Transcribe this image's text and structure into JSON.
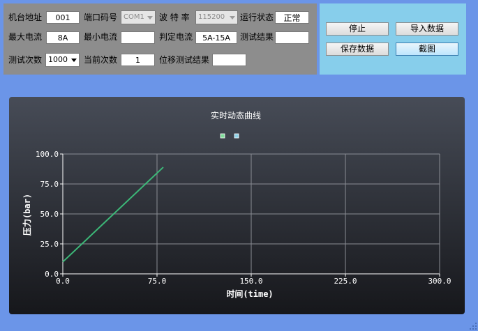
{
  "params": {
    "row1": {
      "machine_addr_label": "机台地址",
      "machine_addr_value": "001",
      "port_label": "端口码号",
      "port_value": "COM1",
      "baud_label": "波 特 率",
      "baud_value": "115200",
      "status_label": "运行状态",
      "status_value": "正常"
    },
    "row2": {
      "max_current_label": "最大电流",
      "max_current_value": "8A",
      "min_current_label": "最小电流",
      "min_current_value": "",
      "judge_current_label": "判定电流",
      "judge_current_value": "5A-15A",
      "test_result_label": "测试结果",
      "test_result_value": ""
    },
    "row3": {
      "test_count_label": "测试次数",
      "test_count_value": "1000",
      "current_count_label": "当前次数",
      "current_count_value": "1",
      "displacement_label": "位移测试结果",
      "displacement_value": ""
    }
  },
  "buttons": {
    "stop": "停止",
    "import": "导入数据",
    "save": "保存数据",
    "screenshot": "截图"
  },
  "chart_data": {
    "type": "line",
    "title": "实时动态曲线",
    "xlabel": "时间(time)",
    "ylabel": "压力(bar)",
    "xlim": [
      0,
      300
    ],
    "ylim": [
      0,
      100
    ],
    "xticks": [
      "0.0",
      "75.0",
      "150.0",
      "225.0",
      "300.0"
    ],
    "yticks": [
      "0.0",
      "25.0",
      "50.0",
      "75.0",
      "100.0"
    ],
    "grid": true,
    "legend_placement": "top-center",
    "legend_colors": [
      "#7fdc9a",
      "#8fd3e8"
    ],
    "series": [
      {
        "color": "#3cb878",
        "x": [
          0,
          80
        ],
        "y": [
          10,
          89
        ]
      }
    ]
  }
}
